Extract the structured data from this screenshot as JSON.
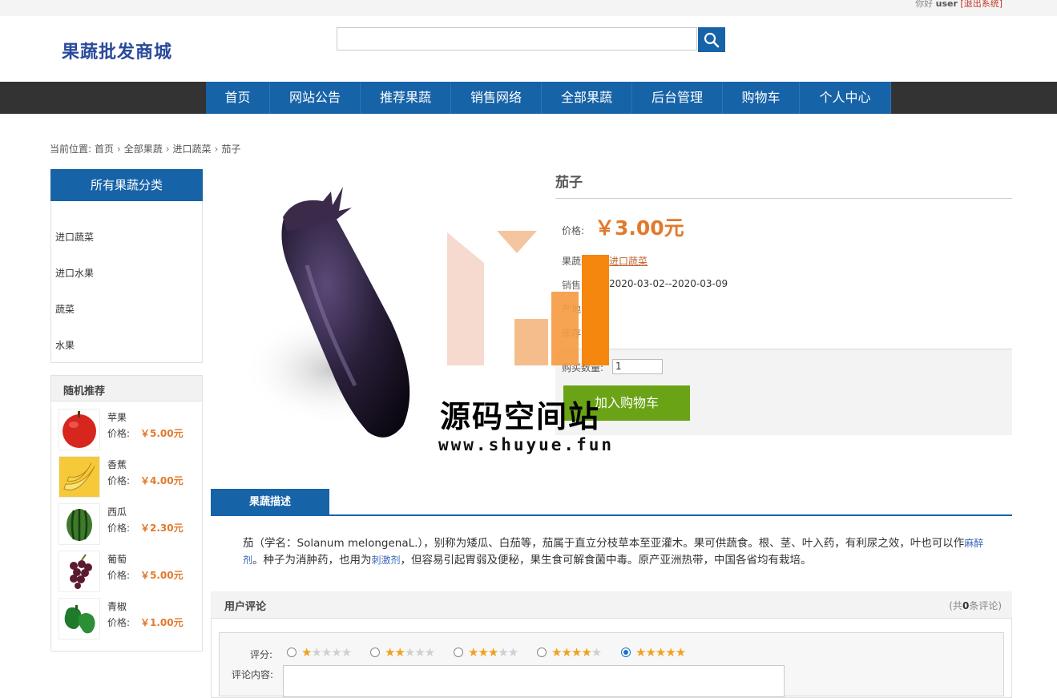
{
  "header": {
    "greeting": "你好",
    "username": "user",
    "logout": "[退出系统]",
    "site_title": "果蔬批发商城",
    "search_placeholder": ""
  },
  "nav": [
    {
      "label": "首页"
    },
    {
      "label": "网站公告"
    },
    {
      "label": "推荐果蔬"
    },
    {
      "label": "销售网络"
    },
    {
      "label": "全部果蔬"
    },
    {
      "label": "后台管理"
    },
    {
      "label": "购物车"
    },
    {
      "label": "个人中心"
    }
  ],
  "breadcrumb": {
    "prefix": "当前位置:",
    "items": [
      "首页",
      "全部果蔬",
      "进口蔬菜",
      "茄子"
    ]
  },
  "categories": {
    "title": "所有果蔬分类",
    "items": [
      "进口蔬菜",
      "进口水果",
      "蔬菜",
      "水果"
    ]
  },
  "recommend": {
    "title": "随机推荐",
    "price_label": "价格:",
    "items": [
      {
        "name": "苹果",
        "price": "￥5.00元"
      },
      {
        "name": "香蕉",
        "price": "￥4.00元"
      },
      {
        "name": "西瓜",
        "price": "￥2.30元"
      },
      {
        "name": "葡萄",
        "price": "￥5.00元"
      },
      {
        "name": "青椒",
        "price": "￥1.00元"
      }
    ]
  },
  "product": {
    "name": "茄子",
    "price_label": "价格:",
    "price": "￥3.00元",
    "category_label": "果蔬类",
    "category": "进口蔬菜",
    "date_label": "销售日",
    "date_range": "2020-03-02--2020-03-09",
    "field3_label": "产地",
    "field4_label": "库存",
    "quantity_label": "购买数量:",
    "quantity": "1",
    "add_to_cart": "加入购物车"
  },
  "watermark": {
    "text": "源码空间站",
    "url": "www.shuyue.fun"
  },
  "description": {
    "tab": "果蔬描述",
    "text_1": "茄（学名：Solanum melongenaL.），别称为矮瓜、白茄等，茄属于直立分枝草本至亚灌木。果可供蔬食。根、茎、叶入药，有利尿之效，叶也可以作",
    "kw_1": "麻醉剂",
    "text_2": "。种子为消肿药，也用为",
    "kw_2": "刺激剂",
    "text_3": "，但容易引起胃弱及便秘，果生食可解食菌中毒。原产亚洲热带，中国各省均有栽培。"
  },
  "comments": {
    "title": "用户评论",
    "count_prefix": "(共",
    "count": "0",
    "count_suffix": "条评论)",
    "rating_label": "评分:",
    "content_label": "评论内容:",
    "selected_rating": 5
  },
  "colors": {
    "primary": "#1763a8",
    "nav_bg": "#333333",
    "price": "#e2792b",
    "cart_button": "#6aa315"
  }
}
